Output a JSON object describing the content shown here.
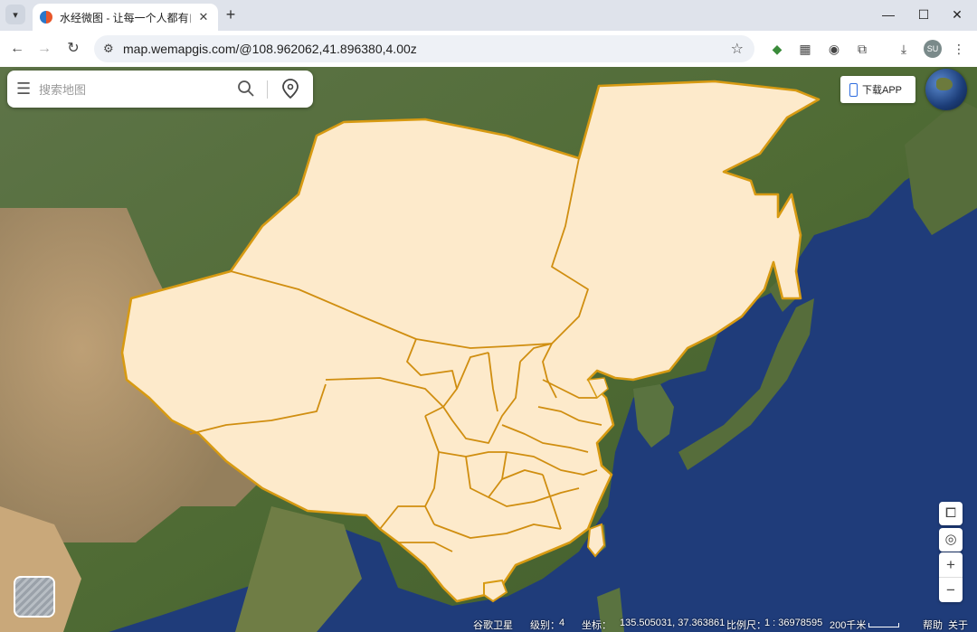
{
  "browser": {
    "tab_title": "水经微图 - 让每一个人都有自己",
    "url": "map.wemapgis.com/@108.962062,41.896380,4.00z",
    "avatar_initials": "SU"
  },
  "map": {
    "search_placeholder": "搜索地图",
    "download_app_label": "下载APP",
    "status": {
      "basemap": "谷歌卫星",
      "level_label": "级别：",
      "level_value": "4",
      "coord_label": "坐标：",
      "coord_value": "135.505031, 37.363861",
      "scale_label": "比例尺：",
      "scale_value": "1 : 36978595",
      "scale_bar": "200千米",
      "help": "帮助",
      "about": "关于"
    },
    "colors": {
      "region_fill": "#fdeacb",
      "region_border": "#d79a12",
      "ocean": "#1f3c7a",
      "land": "#4f6b34"
    }
  }
}
